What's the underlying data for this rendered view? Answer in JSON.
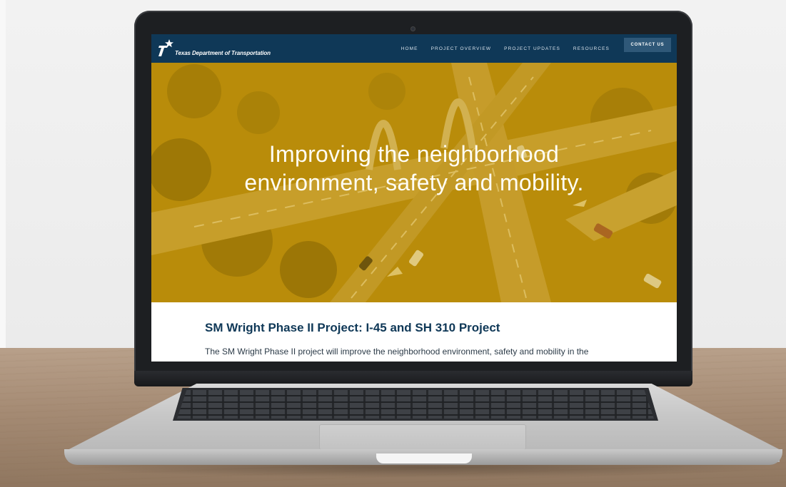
{
  "site": {
    "logo_text": "Texas Department of Transportation",
    "nav": {
      "items": [
        "HOME",
        "PROJECT OVERVIEW",
        "PROJECT UPDATES",
        "RESOURCES"
      ],
      "contact_label": "CONTACT US"
    },
    "hero": {
      "title": "Improving the neighborhood environment, safety and mobility."
    },
    "content": {
      "title": "SM Wright Phase II Project: I-45 and SH 310 Project",
      "text": "The SM Wright Phase II project will improve the neighborhood environment, safety and mobility in the"
    }
  },
  "colors": {
    "nav_bg": "#0f3857",
    "hero_overlay": "#c4960a",
    "title_color": "#0f3857",
    "contact_bg": "#2f5878"
  }
}
